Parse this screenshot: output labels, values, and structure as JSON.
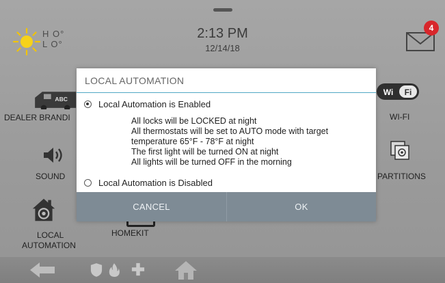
{
  "header": {
    "weather": {
      "high_label": "H O°",
      "low_label": "L O°",
      "icon": "sun-icon"
    },
    "time": "2:13 PM",
    "date": "12/14/18",
    "messages": {
      "icon": "mail-icon",
      "count": "4"
    }
  },
  "tiles": {
    "dealer_branding": "DEALER BRANDI",
    "dealer_van_text": "ABC",
    "wifi": "WI-FI",
    "wifi_badge": "Wi Fi",
    "sound": "SOUND",
    "partitions": "PARTITIONS",
    "local_automation_line1": "LOCAL",
    "local_automation_line2": "AUTOMATION",
    "homekit": "HOMEKIT"
  },
  "dialog": {
    "title": "LOCAL AUTOMATION",
    "option_enabled": "Local Automation is Enabled",
    "option_disabled": "Local Automation is Disabled",
    "selected": "enabled",
    "description": [
      "All locks will be LOCKED at night",
      "All thermostats will be set to AUTO mode with target",
      "temperature 65°F - 78°F at night",
      "The first light will be turned ON at night",
      "All lights will be turned OFF in the morning"
    ],
    "cancel_label": "CANCEL",
    "ok_label": "OK"
  },
  "bottom_bar": {
    "icons": [
      "back-arrow-icon",
      "shield-icon",
      "fire-icon",
      "medical-cross-icon",
      "home-icon"
    ]
  },
  "colors": {
    "accent_line": "#51a8c5",
    "badge_red": "#d8262b",
    "button_bar": "#7e8b95"
  }
}
